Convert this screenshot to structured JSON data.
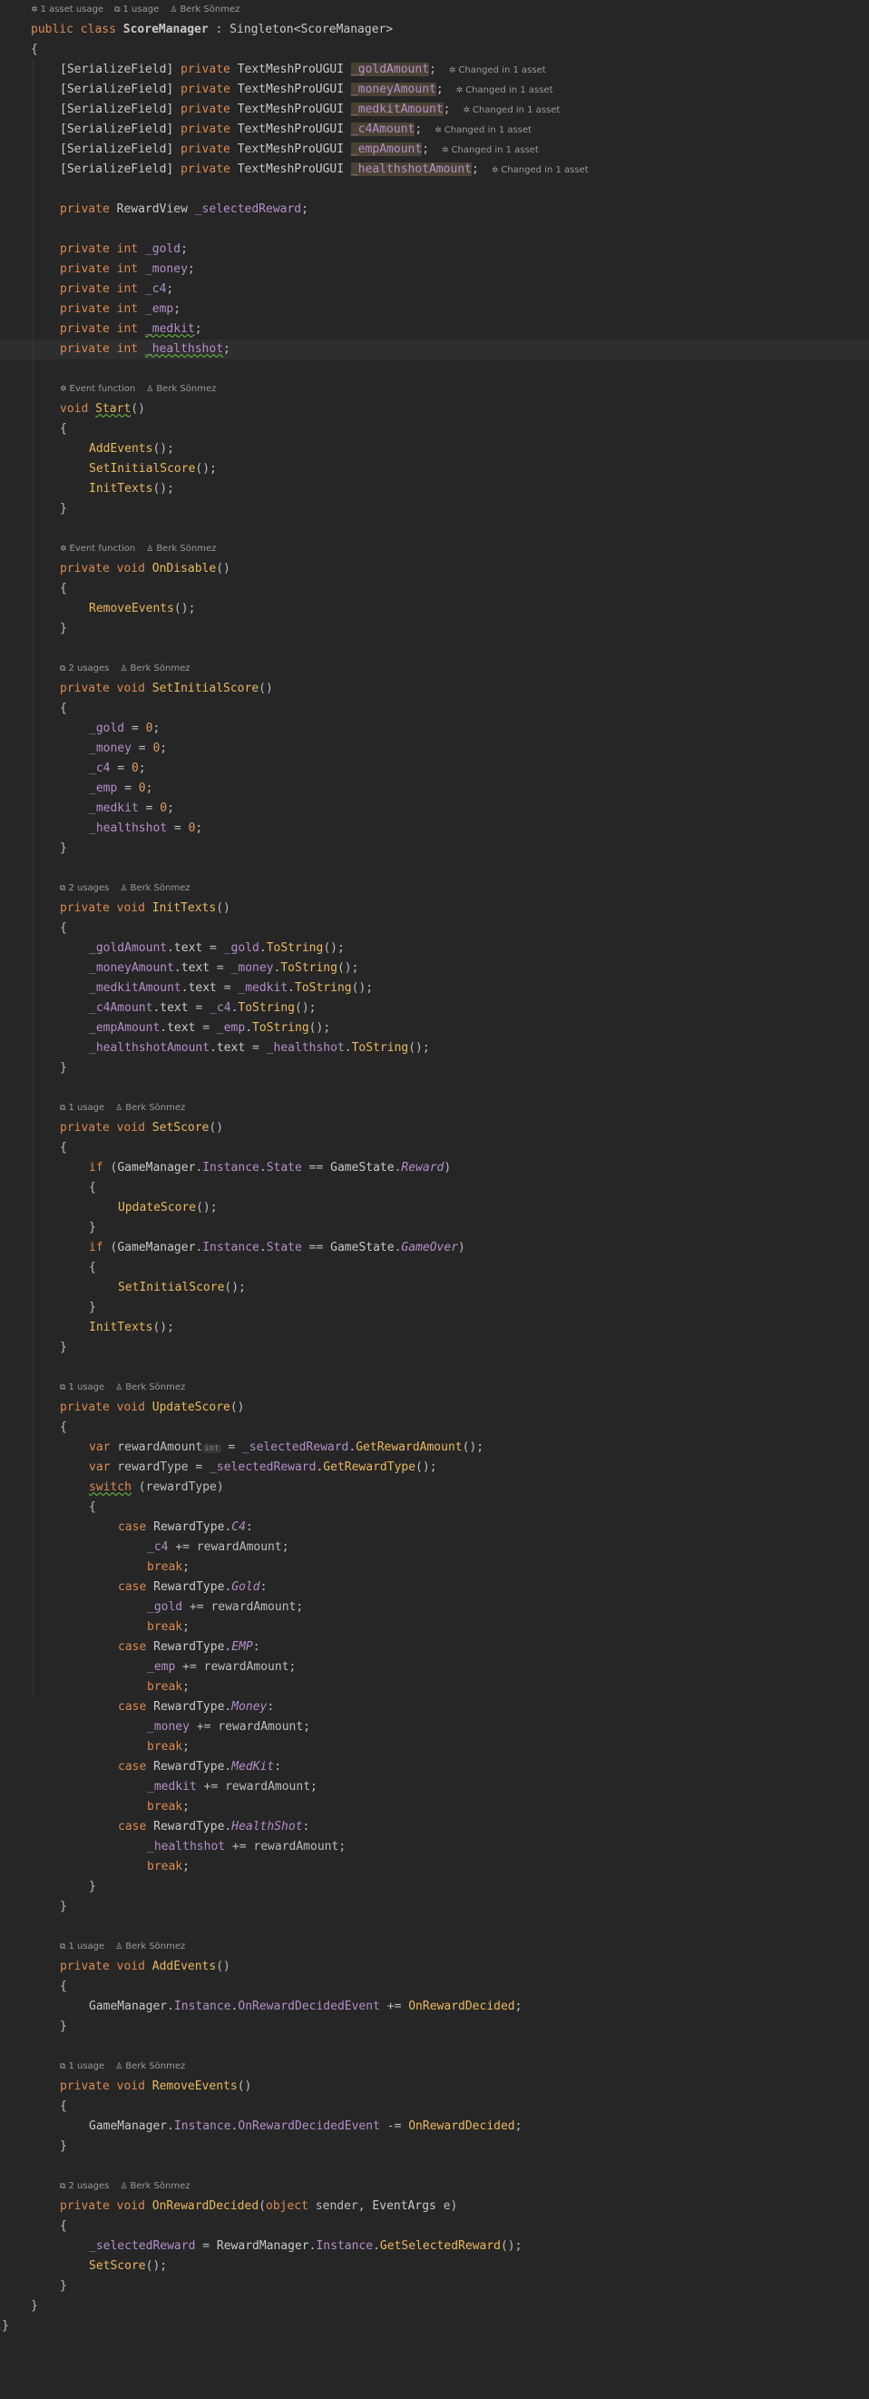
{
  "header_hints": [
    {
      "icon": "unity-asset-icon",
      "text": "1 asset usage"
    },
    {
      "icon": "usage-icon",
      "text": "1 usage"
    },
    {
      "icon": "author-icon",
      "text": "Berk Sönmez"
    }
  ],
  "class_decl": {
    "public": "public",
    "class": "class",
    "name": "ScoreManager",
    "colon": " : ",
    "base": "Singleton<ScoreManager>"
  },
  "serialized_fields": [
    {
      "attr": "[SerializeField]",
      "mod": "private",
      "type": "TextMeshProUGUI",
      "name": "_goldAmount",
      "changed": "Changed in 1 asset"
    },
    {
      "attr": "[SerializeField]",
      "mod": "private",
      "type": "TextMeshProUGUI",
      "name": "_moneyAmount",
      "changed": "Changed in 1 asset"
    },
    {
      "attr": "[SerializeField]",
      "mod": "private",
      "type": "TextMeshProUGUI",
      "name": "_medkitAmount",
      "changed": "Changed in 1 asset"
    },
    {
      "attr": "[SerializeField]",
      "mod": "private",
      "type": "TextMeshProUGUI",
      "name": "_c4Amount",
      "changed": "Changed in 1 asset"
    },
    {
      "attr": "[SerializeField]",
      "mod": "private",
      "type": "TextMeshProUGUI",
      "name": "_empAmount",
      "changed": "Changed in 1 asset"
    },
    {
      "attr": "[SerializeField]",
      "mod": "private",
      "type": "TextMeshProUGUI",
      "name": "_healthshotAmount",
      "changed": "Changed in 1 asset"
    }
  ],
  "reward_field": {
    "mod": "private",
    "type": "RewardView",
    "name": "_selectedReward"
  },
  "int_fields": [
    {
      "mod": "private",
      "type": "int",
      "name": "_gold"
    },
    {
      "mod": "private",
      "type": "int",
      "name": "_money"
    },
    {
      "mod": "private",
      "type": "int",
      "name": "_c4"
    },
    {
      "mod": "private",
      "type": "int",
      "name": "_emp"
    },
    {
      "mod": "private",
      "type": "int",
      "name": "_medkit"
    },
    {
      "mod": "private",
      "type": "int",
      "name": "_healthshot"
    }
  ],
  "hints": {
    "event_function": "Event function",
    "two_usages": "2 usages",
    "one_usage": "1 usage",
    "author": "Berk Sönmez"
  },
  "methods": {
    "start": "Start",
    "on_disable": "OnDisable",
    "set_initial_score": "SetInitialScore",
    "init_texts": "InitTexts",
    "set_score": "SetScore",
    "update_score": "UpdateScore",
    "add_events": "AddEvents",
    "remove_events": "RemoveEvents",
    "on_reward_decided": "OnRewardDecided"
  },
  "inlay_int": "int",
  "reward_cases": [
    {
      "enum": "C4",
      "field": "_c4"
    },
    {
      "enum": "Gold",
      "field": "_gold"
    },
    {
      "enum": "EMP",
      "field": "_emp"
    },
    {
      "enum": "Money",
      "field": "_money"
    },
    {
      "enum": "MedKit",
      "field": "_medkit"
    },
    {
      "enum": "HealthShot",
      "field": "_healthshot"
    }
  ]
}
